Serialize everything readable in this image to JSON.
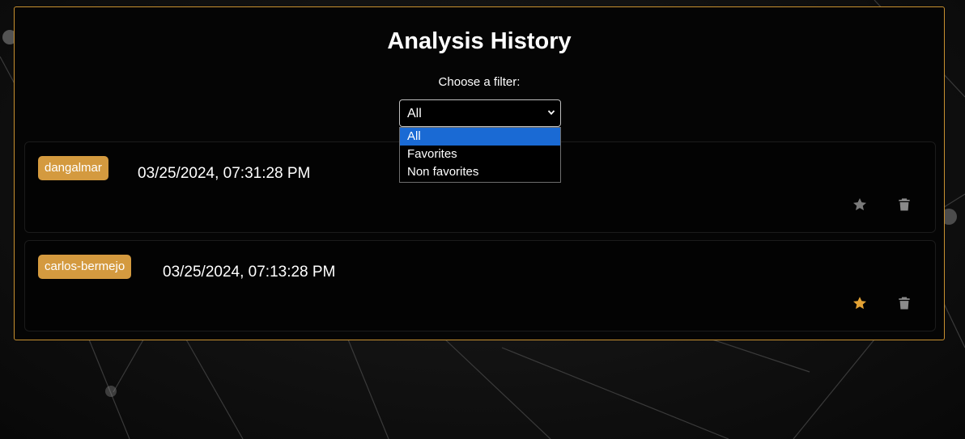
{
  "page": {
    "title": "Analysis History",
    "filter_label": "Choose a filter:"
  },
  "filter": {
    "selected": "All",
    "options": [
      "All",
      "Favorites",
      "Non favorites"
    ],
    "highlighted_index": 0
  },
  "history": [
    {
      "user": "dangalmar",
      "datetime": "03/25/2024, 07:31:28 PM",
      "favorite": false
    },
    {
      "user": "carlos-bermejo",
      "datetime": "03/25/2024, 07:13:28 PM",
      "favorite": true
    }
  ],
  "colors": {
    "accent": "#d49a3f",
    "border": "#c8902f",
    "favorite_on": "#e3a234",
    "favorite_off": "#7a7a7a",
    "trash": "#8a8a8a",
    "option_highlight": "#1a6ad4"
  },
  "icons": {
    "favorite": "star-icon",
    "delete": "trash-icon",
    "dropdown": "chevron-down-icon"
  }
}
